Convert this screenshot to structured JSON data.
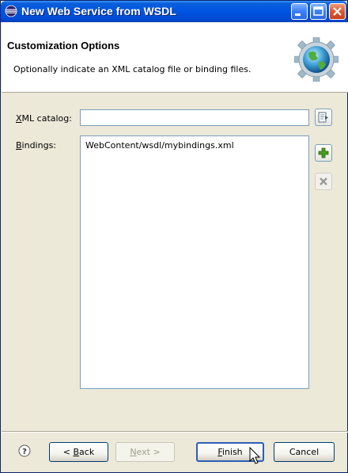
{
  "window": {
    "title": "New Web Service from WSDL"
  },
  "header": {
    "title": "Customization Options",
    "description": "Optionally indicate an XML catalog file or binding files."
  },
  "form": {
    "catalog_label_mnemonic": "X",
    "catalog_label_rest": "ML catalog:",
    "catalog_value": "",
    "bindings_label_mnemonic": "B",
    "bindings_label_rest": "indings:",
    "bindings_items": [
      "WebContent/wsdl/mybindings.xml"
    ]
  },
  "buttons": {
    "back_prefix": "< ",
    "back_mnemonic": "B",
    "back_rest": "ack",
    "next_mnemonic": "N",
    "next_rest": "ext >",
    "finish_mnemonic": "F",
    "finish_rest": "inish",
    "cancel": "Cancel"
  },
  "icons": {
    "window_icon": "eclipse-icon",
    "header_image": "globe-wizard-icon",
    "browse": "browse-icon",
    "add": "add-icon",
    "remove": "remove-icon",
    "help": "help-icon",
    "cursor": "mouse-pointer-icon"
  },
  "colors": {
    "titlebar": "#0054e3",
    "window_bg": "#ece9d8",
    "default_button_border": "#2d5fb6",
    "add_icon": "#4a9a1e",
    "remove_icon_disabled": "#9a9a9a"
  },
  "state": {
    "next_enabled": false,
    "remove_enabled": false
  }
}
